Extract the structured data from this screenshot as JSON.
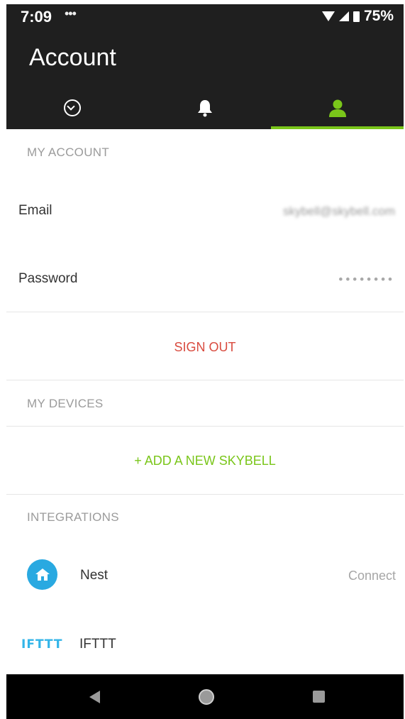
{
  "status_bar": {
    "time": "7:09",
    "notification_indicator": "•••",
    "battery_percent": "75%"
  },
  "app_bar": {
    "title": "Account",
    "tabs": [
      {
        "icon": "history-icon",
        "selected": false
      },
      {
        "icon": "bell-icon",
        "selected": false
      },
      {
        "icon": "person-icon",
        "selected": true
      }
    ],
    "accent_color": "#7ac61a"
  },
  "my_account": {
    "header": "MY ACCOUNT",
    "email_label": "Email",
    "email_value": "skybell@skybell.com",
    "password_label": "Password",
    "password_value": "••••••••"
  },
  "sign_out_label": "SIGN OUT",
  "my_devices": {
    "header": "MY DEVICES",
    "add_label": "+ ADD A NEW SKYBELL"
  },
  "integrations": {
    "header": "INTEGRATIONS",
    "items": [
      {
        "name": "Nest",
        "action": "Connect",
        "icon": "nest-home-icon"
      },
      {
        "name": "IFTTT",
        "logo": "IFTTT",
        "icon": "ifttt-logo"
      }
    ]
  },
  "nav_bar": {
    "icons": [
      "back-icon",
      "home-icon",
      "recents-icon"
    ]
  }
}
